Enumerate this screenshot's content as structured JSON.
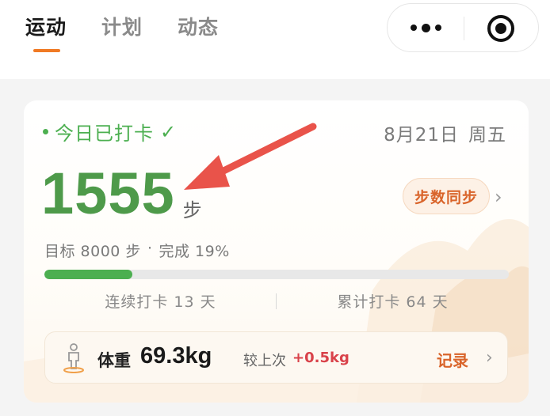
{
  "tabs": [
    {
      "label": "运动",
      "active": true
    },
    {
      "label": "计划",
      "active": false
    },
    {
      "label": "动态",
      "active": false
    }
  ],
  "capsule": {
    "more_icon": "more-dots-icon",
    "close_icon": "target-close-icon"
  },
  "card": {
    "status": "今日已打卡",
    "status_check": "✓",
    "date": "8月21日",
    "weekday": "周五",
    "steps": "1555",
    "steps_unit": "步",
    "sync_label": "步数同步",
    "sync_chevron": "›",
    "goal_text": "目标 8000 步",
    "goal_sep": "·",
    "complete_text": "完成 19%",
    "progress": 0.19,
    "streak_text": "连续打卡 13 天",
    "total_text": "累计打卡 64 天"
  },
  "weight": {
    "icon": "person-scale-icon",
    "label": "体重",
    "value": "69.3kg",
    "compare_label": "较上次",
    "delta": "+0.5kg",
    "record_label": "记录",
    "chevron": "›"
  },
  "colors": {
    "accent": "#f07a24",
    "green": "#4caf50",
    "steps_green": "#4e9a4a",
    "annotation_arrow": "#e9534a",
    "delta_red": "#d9424a",
    "record_orange": "#d9642a"
  }
}
